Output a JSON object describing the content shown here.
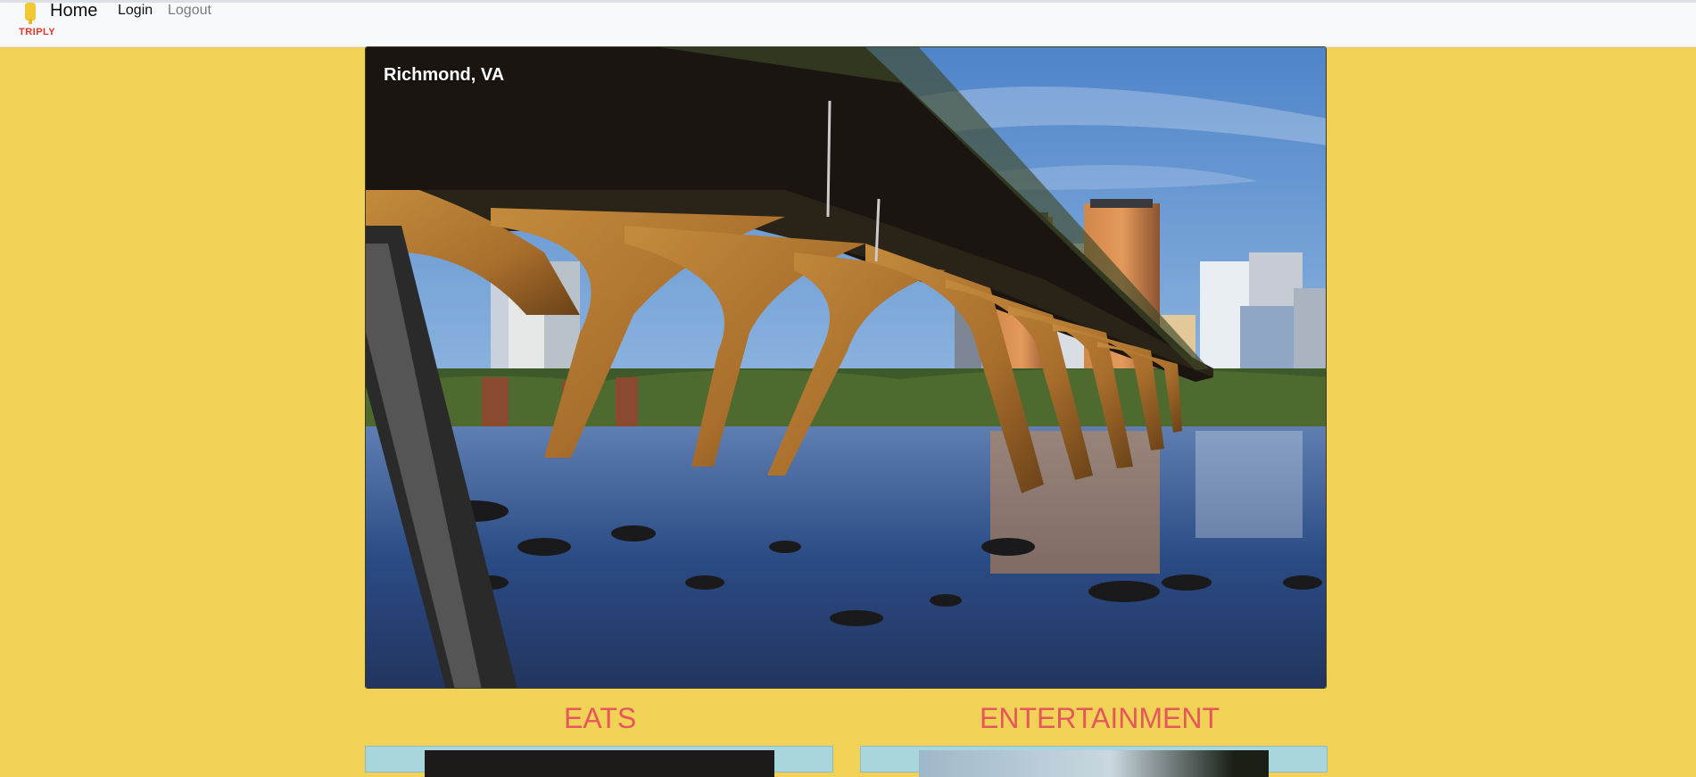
{
  "navbar": {
    "logo_text": "TRIPLY",
    "brand": "Home",
    "links": [
      "Login",
      "Logout"
    ]
  },
  "hero": {
    "title": "Richmond, VA",
    "image": "richmond-bridge-skyline-photo"
  },
  "sections": [
    {
      "title": "EATS"
    },
    {
      "title": "ENTERTAINMENT"
    }
  ],
  "colors": {
    "background": "#f2d256",
    "navbar": "#f8f9fb",
    "section_title": "#e4585a",
    "logo_text": "#e4362a",
    "card": "#a9d6dd"
  }
}
